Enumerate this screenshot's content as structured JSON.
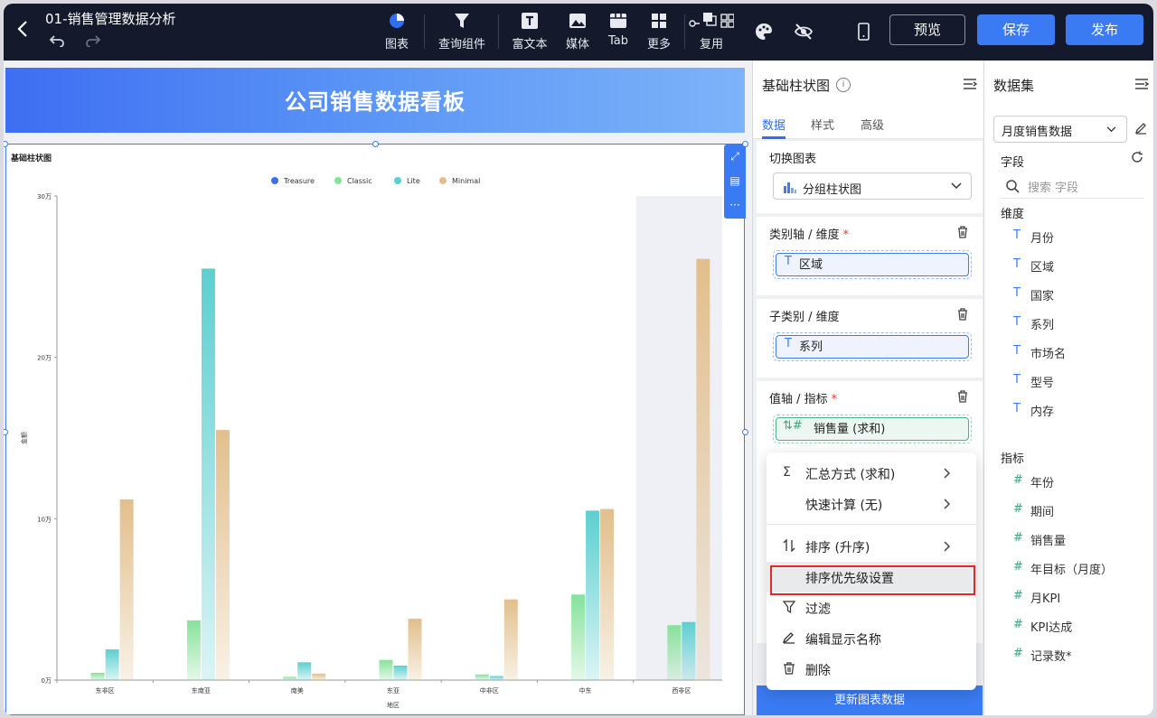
{
  "header": {
    "doc_title": "01-销售管理数据分析",
    "tools": [
      {
        "label": "图表",
        "icon": "pie-chart-icon"
      },
      {
        "label": "查询组件",
        "icon": "filter-icon"
      },
      {
        "label": "富文本",
        "icon": "text-icon"
      },
      {
        "label": "媒体",
        "icon": "image-icon"
      },
      {
        "label": "Tab",
        "icon": "tab-icon"
      },
      {
        "label": "更多",
        "icon": "grid-icon"
      },
      {
        "label": "复用",
        "icon": "reuse-icon"
      }
    ],
    "preview_label": "预览",
    "save_label": "保存",
    "publish_label": "发布"
  },
  "banner": {
    "title": "公司销售数据看板"
  },
  "chart": {
    "title": "基础柱状图"
  },
  "chart_data": {
    "type": "bar",
    "title": "",
    "categories": [
      "东非区",
      "东南亚",
      "南美",
      "东亚",
      "中非区",
      "中东",
      "西非区"
    ],
    "series": [
      {
        "name": "Treasure",
        "values": [
          0,
          0,
          0,
          0,
          0,
          0,
          0
        ]
      },
      {
        "name": "Classic",
        "values": [
          4500,
          37000,
          2000,
          12500,
          3500,
          53000,
          34000
        ]
      },
      {
        "name": "Lite",
        "values": [
          19000,
          255000,
          11000,
          9000,
          2500,
          105000,
          36000
        ]
      },
      {
        "name": "Minimal",
        "values": [
          112000,
          155000,
          4000,
          38000,
          50000,
          106000,
          261000
        ]
      }
    ],
    "series_colors": [
      "#3f6fe8",
      "#86e29a",
      "#5ccfd0",
      "#e2bf8c"
    ],
    "xlabel": "地区",
    "ylabel": "金额",
    "yticks": [
      "0万",
      "10万",
      "20万",
      "30万"
    ],
    "ylim": [
      0,
      300000
    ],
    "legend": "top-center",
    "highlight_category": "西非区"
  },
  "config": {
    "panel_title": "基础柱状图",
    "tabs": [
      "数据",
      "样式",
      "高级"
    ],
    "switch_chart_label": "切换图表",
    "switch_chart_value": "分组柱状图",
    "category_axis_label": "类别轴 / 维度",
    "category_axis_value": "区域",
    "subcategory_label": "子类别 / 维度",
    "subcategory_value": "系列",
    "value_axis_label": "值轴 / 指标",
    "value_axis_value": "销售量 (求和)",
    "update_button": "更新图表数据"
  },
  "context_menu": {
    "items": [
      {
        "label": "汇总方式 (求和)",
        "icon": "sigma-icon",
        "submenu": true
      },
      {
        "label": "快速计算 (无)",
        "icon": "",
        "submenu": true
      },
      {
        "label": "排序 (升序)",
        "icon": "sort-icon",
        "submenu": true
      },
      {
        "label": "排序优先级设置",
        "icon": "",
        "submenu": false
      },
      {
        "label": "过滤",
        "icon": "filter-icon",
        "submenu": false
      },
      {
        "label": "编辑显示名称",
        "icon": "edit-icon",
        "submenu": false
      },
      {
        "label": "删除",
        "icon": "trash-icon",
        "submenu": false
      }
    ]
  },
  "dataset": {
    "title": "数据集",
    "selected": "月度销售数据",
    "fields_label": "字段",
    "search_placeholder": "搜索 字段",
    "dimensions_label": "维度",
    "dimensions": [
      "月份",
      "区域",
      "国家",
      "系列",
      "市场名",
      "型号",
      "内存"
    ],
    "measures_label": "指标",
    "measures": [
      "年份",
      "期间",
      "销售量",
      "年目标（月度）",
      "月KPI",
      "KPI达成",
      "记录数*"
    ]
  }
}
